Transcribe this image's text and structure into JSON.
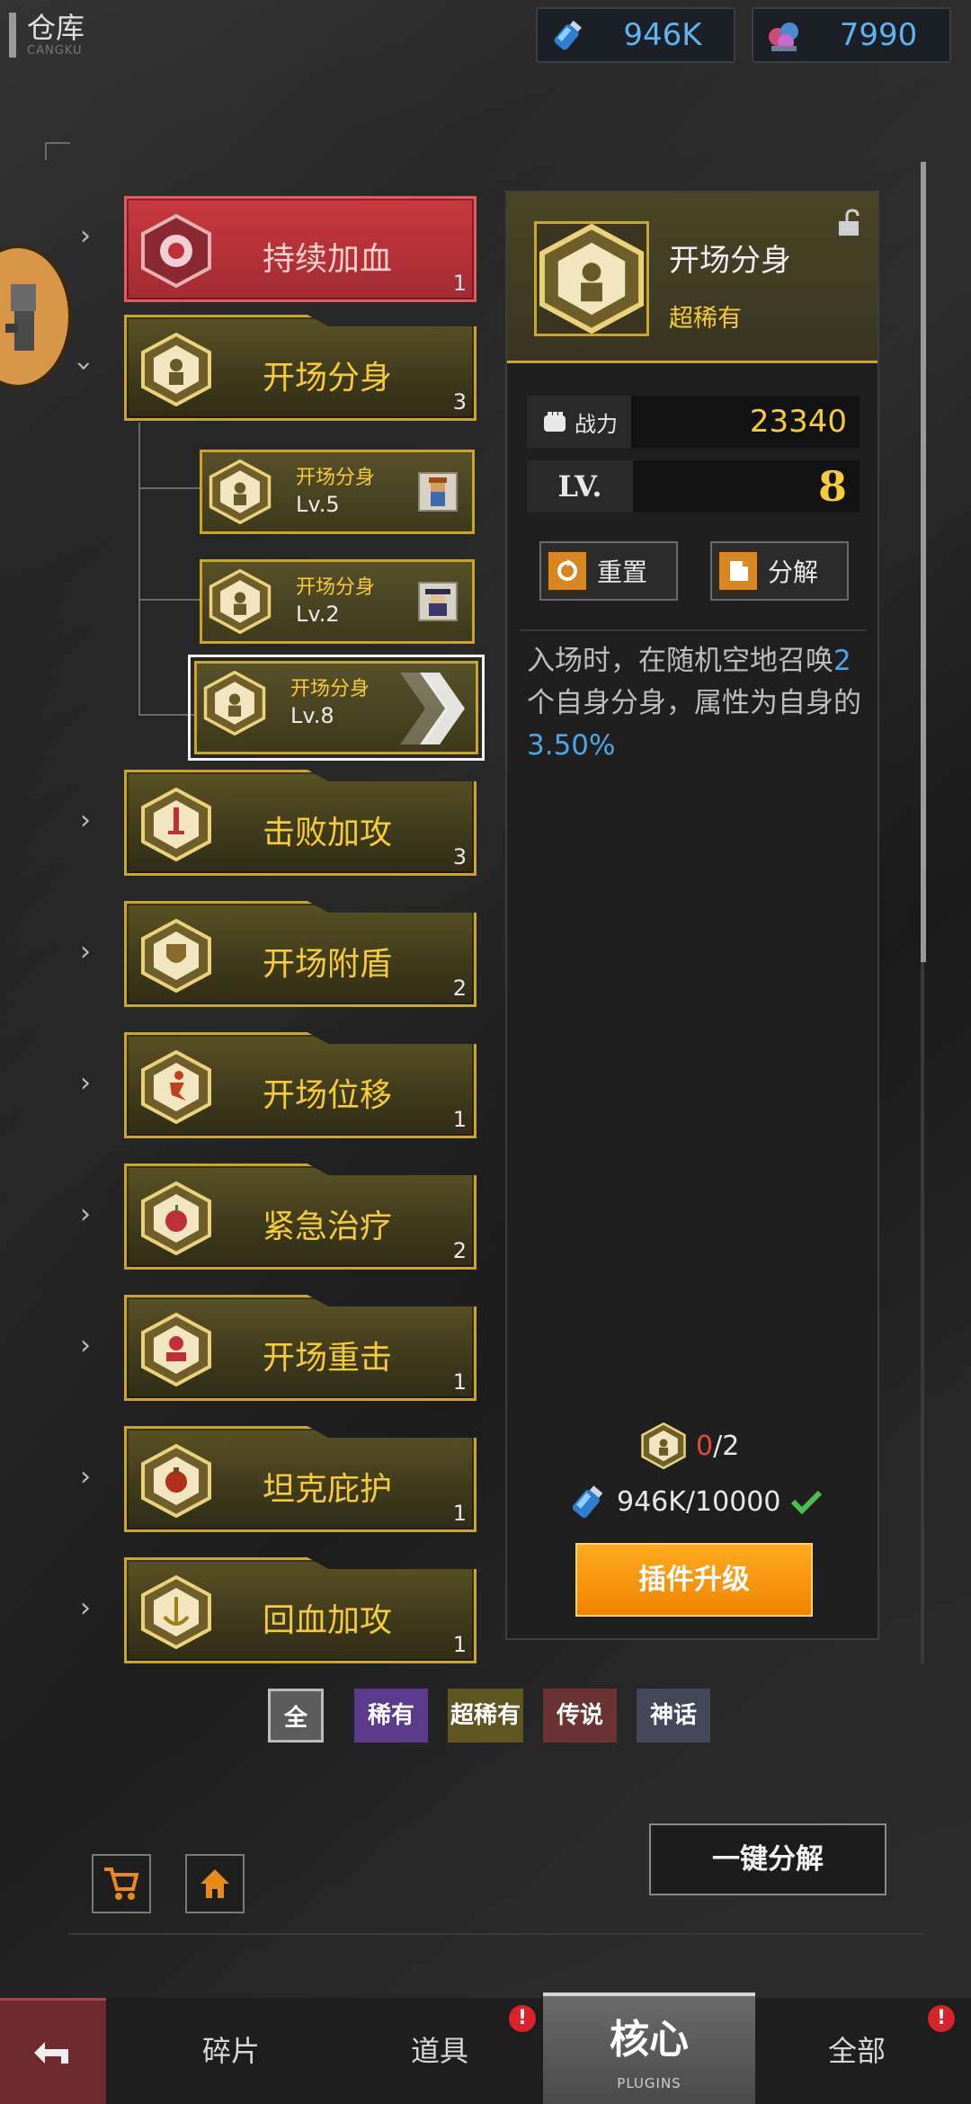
{
  "header": {
    "title": "仓库",
    "title_sub": "CANGKU",
    "resources": [
      {
        "icon": "energy-bottle-icon",
        "value": "946K"
      },
      {
        "icon": "gem-pile-icon",
        "value": "7990"
      }
    ]
  },
  "plugin_list": [
    {
      "name": "持续加血",
      "count": "1",
      "rarity": "传说",
      "expanded": false
    },
    {
      "name": "开场分身",
      "count": "3",
      "rarity": "超稀有",
      "expanded": true,
      "instances": [
        {
          "name": "开场分身",
          "level": "Lv.5"
        },
        {
          "name": "开场分身",
          "level": "Lv.2"
        },
        {
          "name": "开场分身",
          "level": "Lv.8",
          "selected": true
        }
      ]
    },
    {
      "name": "击败加攻",
      "count": "3"
    },
    {
      "name": "开场附盾",
      "count": "2"
    },
    {
      "name": "开场位移",
      "count": "1"
    },
    {
      "name": "紧急治疗",
      "count": "2"
    },
    {
      "name": "开场重击",
      "count": "1"
    },
    {
      "name": "坦克庇护",
      "count": "1"
    },
    {
      "name": "回血加攻",
      "count": "1"
    }
  ],
  "detail": {
    "title": "开场分身",
    "rarity": "超稀有",
    "power_label": "战力",
    "power_value": "23340",
    "level_label": "LV.",
    "level_value": "8",
    "reset_label": "重置",
    "dismantle_label": "分解",
    "desc_part1": "入场时，在随机空地召唤",
    "desc_num1": "2",
    "desc_part2": "个自身分身，属性为自身的",
    "desc_num2": "3.50%",
    "cost_owned": "0",
    "cost_needed": "/2",
    "energy_cost": "946K/10000",
    "upgrade_label": "插件升级"
  },
  "filters": [
    {
      "label": "全",
      "color": "#5c5c5c"
    },
    {
      "label": "稀有",
      "color": "#5b3a8c"
    },
    {
      "label": "超稀有",
      "color": "#5e5520"
    },
    {
      "label": "传说",
      "color": "#6a3232"
    },
    {
      "label": "神话",
      "color": "#44465a"
    }
  ],
  "tools": {
    "dismantle_all_label": "一键分解"
  },
  "nav": {
    "tabs": [
      {
        "label": "碎片"
      },
      {
        "label": "道具"
      },
      {
        "label": "核心",
        "sub": "PLUGINS",
        "active": true
      },
      {
        "label": "全部"
      }
    ]
  },
  "colors": {
    "gold": "#c9a52d",
    "gold_text": "#f4cb3a",
    "blue_highlight": "#4aa8e8",
    "orange_button": "#f08300",
    "red_card": "#a32b31"
  }
}
